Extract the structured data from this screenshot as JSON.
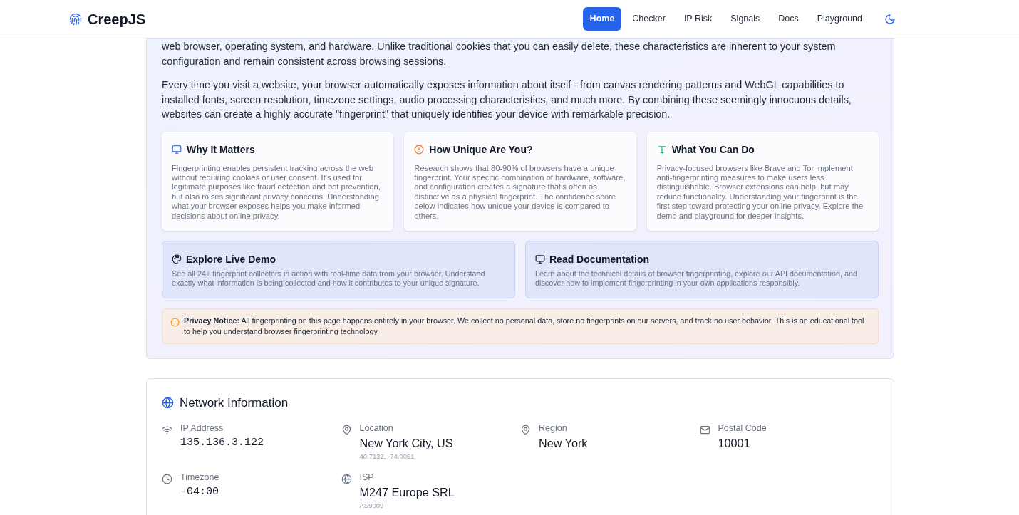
{
  "header": {
    "logo": "CreepJS",
    "nav": [
      {
        "label": "Home",
        "selected": true
      },
      {
        "label": "Checker",
        "selected": false
      },
      {
        "label": "IP Risk",
        "selected": false
      },
      {
        "label": "Signals",
        "selected": false
      },
      {
        "label": "Docs",
        "selected": false
      },
      {
        "label": "Playground",
        "selected": false
      }
    ]
  },
  "intro": {
    "paragraphs": [
      "web browser, operating system, and hardware. Unlike traditional cookies that you can easily delete, these characteristics are inherent to your system configuration and remain consistent across browsing sessions.",
      "Every time you visit a website, your browser automatically exposes information about itself - from canvas rendering patterns and WebGL capabilities to installed fonts, screen resolution, timezone settings, audio processing characteristics, and much more. By combining these seemingly innocuous details, websites can create a highly accurate \"fingerprint\" that uniquely identifies your device with remarkable precision."
    ],
    "cards": [
      {
        "title": "Why It Matters",
        "text": "Fingerprinting enables persistent tracking across the web without requiring cookies or user consent. It's used for legitimate purposes like fraud detection and bot prevention, but also raises significant privacy concerns. Understanding what your browser exposes helps you make informed decisions about online privacy."
      },
      {
        "title": "How Unique Are You?",
        "text": "Research shows that 80-90% of browsers have a unique fingerprint. Your specific combination of hardware, software, and configuration creates a signature that's often as distinctive as a physical fingerprint. The confidence score below indicates how unique your device is compared to others."
      },
      {
        "title": "What You Can Do",
        "text": "Privacy-focused browsers like Brave and Tor implement anti-fingerprinting measures to make users less distinguishable. Browser extensions can help, but may reduce functionality. Understanding your fingerprint is the first step toward protecting your online privacy. Explore the demo and playground for deeper insights."
      }
    ],
    "links": [
      {
        "title": "Explore Live Demo",
        "text": "See all 24+ fingerprint collectors in action with real-time data from your browser. Understand exactly what information is being collected and how it contributes to your unique signature."
      },
      {
        "title": "Read Documentation",
        "text": "Learn about the technical details of browser fingerprinting, explore our API documentation, and discover how to implement fingerprinting in your own applications responsibly."
      }
    ],
    "notice": "**Privacy Notice:** All fingerprinting on this page happens entirely in your browser. We collect no personal data, store no fingerprints on our servers, and track no user behavior. This is an educational tool to help you understand browser fingerprinting technology."
  },
  "network": {
    "title": "Network Information",
    "items": [
      {
        "label": "IP Address",
        "value": "135.136.3.122",
        "kind": "mono"
      },
      {
        "label": "Location",
        "value": "New York City, US",
        "sub": "40.7132, -74.0061",
        "kind": "text"
      },
      {
        "label": "Region",
        "value": "New York",
        "kind": "text"
      },
      {
        "label": "Postal Code",
        "value": "10001",
        "kind": "text"
      },
      {
        "label": "Timezone",
        "value": "-04:00",
        "kind": "mono"
      },
      {
        "label": "ISP",
        "value": "M247 Europe SRL",
        "sub": "AS9009",
        "kind": "text"
      }
    ]
  }
}
